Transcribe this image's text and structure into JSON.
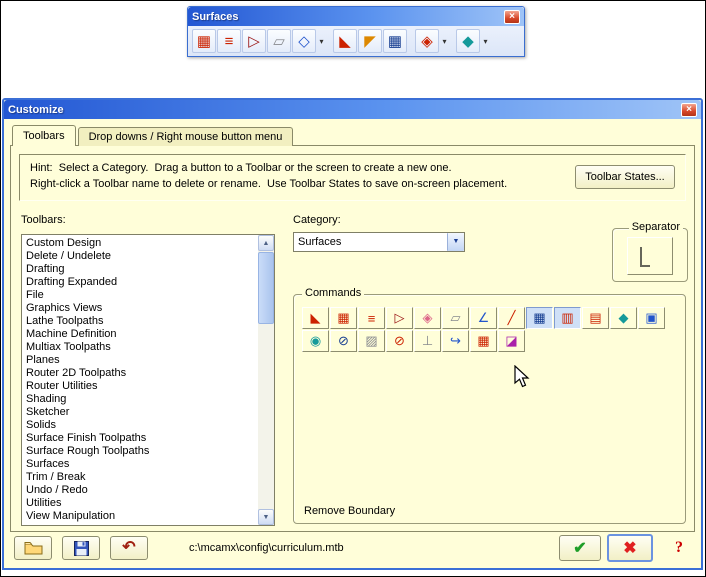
{
  "theme": {
    "titlebar_start": "#2357d3",
    "titlebar_mid": "#5b93ef",
    "titlebar_end": "#9fc4f7",
    "dialog_bg": "#fffed9",
    "check_green": "#1f9e28",
    "cancel_red": "#e02020"
  },
  "icons": {
    "close": "×",
    "up": "▲",
    "down": "▼",
    "combo_arrow": "▼",
    "dropdown": "▾",
    "undo": "↶",
    "check": "✔",
    "cross": "✖"
  },
  "surfaces_toolbar": {
    "title": "Surfaces",
    "buttons": [
      "▦",
      "≡",
      "▷",
      "▱",
      "◇",
      "◣",
      "◤",
      "▦",
      "◈",
      "◆"
    ]
  },
  "dialog": {
    "title": "Customize",
    "tabs": [
      "Toolbars",
      "Drop downs / Right mouse button menu"
    ],
    "hint_line1": "Hint:  Select a Category.  Drag a button to a Toolbar or the screen to create a new one.",
    "hint_line2": "Right-click a Toolbar name to delete or rename.  Use Toolbar States to save on-screen placement.",
    "toolbar_states_button": "Toolbar States...",
    "toolbars_label": "Toolbars:",
    "toolbars": [
      "Custom Design",
      "Delete / Undelete",
      "Drafting",
      "Drafting Expanded",
      "File",
      "Graphics Views",
      "Lathe Toolpaths",
      "Machine Definition",
      "Multiax Toolpaths",
      "Planes",
      "Router 2D Toolpaths",
      "Router Utilities",
      "Shading",
      "Sketcher",
      "Solids",
      "Surface Finish Toolpaths",
      "Surface Rough Toolpaths",
      "Surfaces",
      "Trim / Break",
      "Undo / Redo",
      "Utilities",
      "View Manipulation"
    ],
    "category_label": "Category:",
    "category_value": "Surfaces",
    "separator_label": "Separator",
    "commands_label": "Commands",
    "commands_row1": [
      "◣",
      "▦",
      "≡",
      "▷",
      "◈",
      "▱",
      "∠",
      "╱",
      "▦",
      "▥",
      "▤",
      "◆",
      "▣"
    ],
    "commands_row2": [
      "◉",
      "⊘",
      "▨",
      "⊘",
      "⊥",
      "↪",
      "▦",
      "◪"
    ],
    "selected_command_hint": "Remove Boundary"
  },
  "footer": {
    "path": "c:\\mcamx\\config\\curriculum.mtb",
    "help_label": "?"
  }
}
